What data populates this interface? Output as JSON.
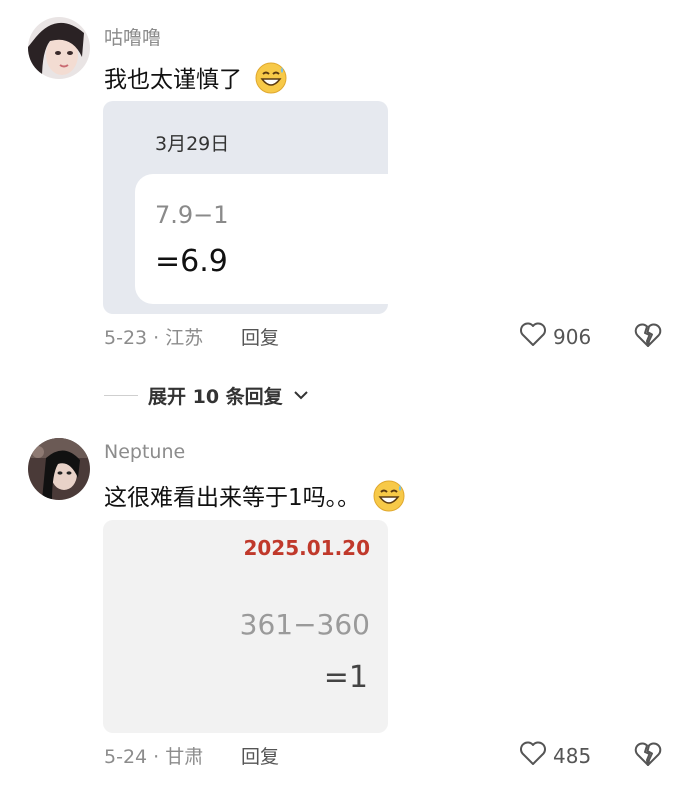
{
  "comments": [
    {
      "username": "咕噜噜",
      "text": "我也太谨慎了",
      "emoji": "grin-sweat-icon",
      "image": {
        "date": "3月29日",
        "expression": "7.9−1",
        "result": "=6.9"
      },
      "meta": "5-23 · 江苏",
      "reply_label": "回复",
      "likes": "906"
    },
    {
      "username": "Neptune",
      "text": "这很难看出来等于1吗。。",
      "emoji": "grin-sweat-icon",
      "image": {
        "date": "2025.01.20",
        "expression": "361−360",
        "result": "=1"
      },
      "meta": "5-24 · 甘肃",
      "reply_label": "回复",
      "likes": "485"
    }
  ],
  "expand_replies": {
    "label": "展开 10 条回复"
  },
  "colors": {
    "meta_gray": "#8c8c8c",
    "date_red": "#c0392b",
    "card1_bg": "#e6e9ef",
    "card2_bg": "#f2f2f2"
  }
}
